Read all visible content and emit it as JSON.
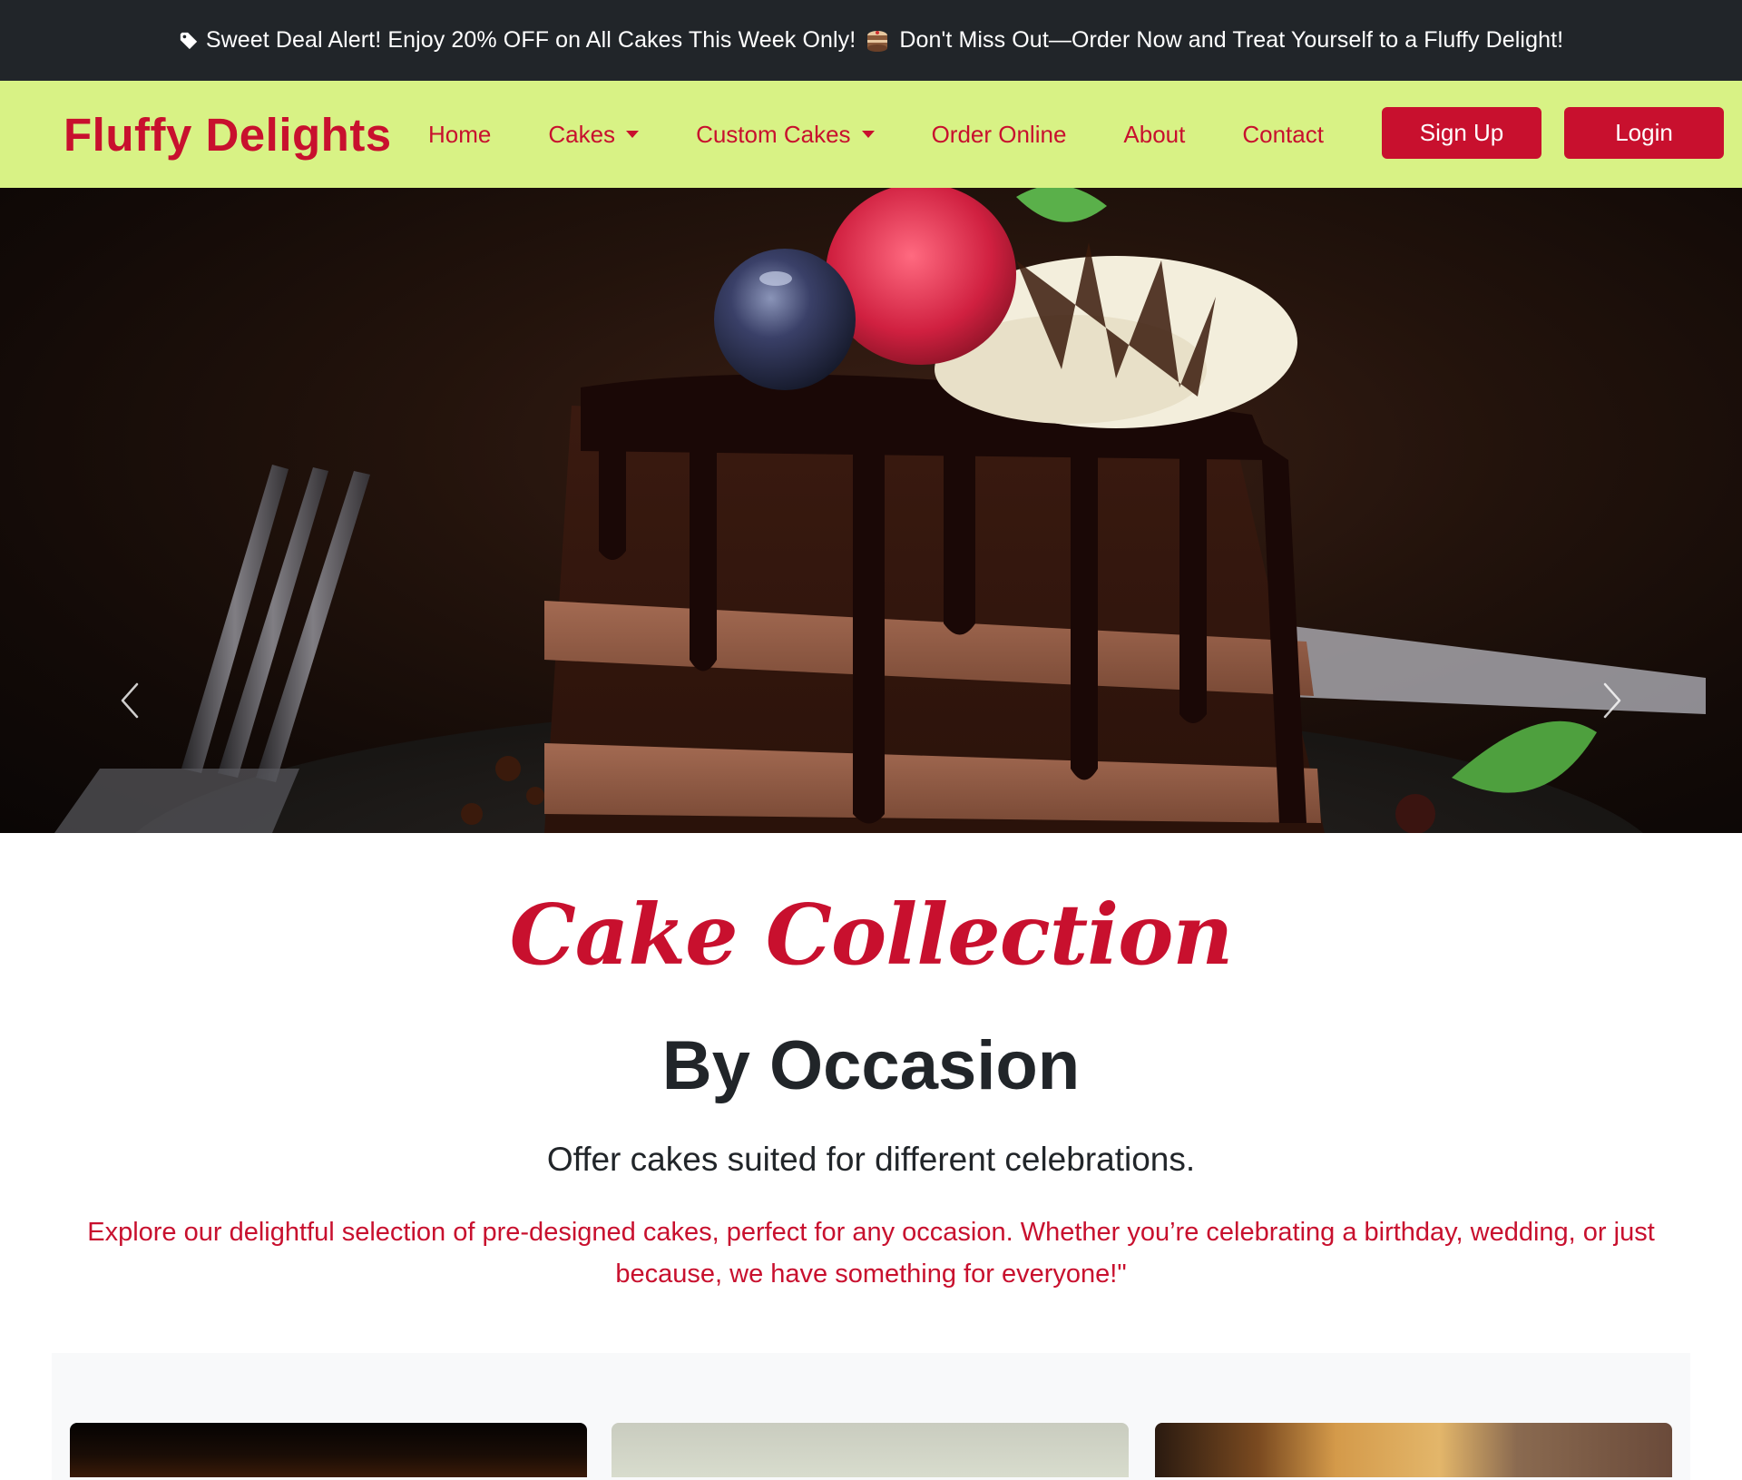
{
  "promo": {
    "text_before": "Sweet Deal Alert! Enjoy 20% OFF on All Cakes This Week Only!",
    "text_after": "Don't Miss Out—Order Now and Treat Yourself to a Fluffy Delight!",
    "icons": [
      "tag-icon",
      "cake-icon"
    ]
  },
  "navbar": {
    "brand": "Fluffy Delights",
    "links": {
      "home": "Home",
      "cakes": "Cakes",
      "custom_cakes": "Custom Cakes",
      "order_online": "Order Online",
      "about": "About",
      "contact": "Contact"
    },
    "buttons": {
      "signup": "Sign Up",
      "login": "Login"
    }
  },
  "hero": {
    "prev_icon": "chevron-left-icon",
    "next_icon": "chevron-right-icon"
  },
  "collection": {
    "script_title": "Cake Collection",
    "title": "By Occasion",
    "subtitle": "Offer cakes suited for different celebrations.",
    "description": "Explore our delightful selection of pre-designed cakes, perfect for any occasion. Whether you’re celebrating a birthday, wedding, or just because, we have something for everyone!\""
  },
  "colors": {
    "accent": "#c8102e",
    "navbar_bg": "#d8f285",
    "promo_bg": "#212529",
    "text_dark": "#212529"
  }
}
